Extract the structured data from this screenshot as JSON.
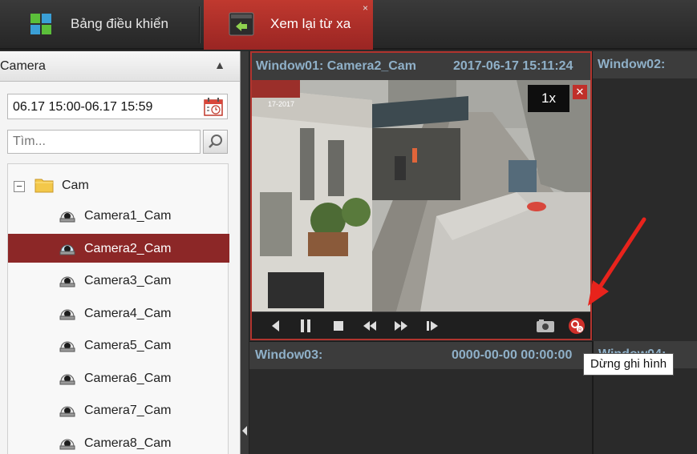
{
  "tabs": {
    "dashboard_label": "Bảng điều khiển",
    "remote_label": "Xem lại từ xa",
    "remote_close": "×"
  },
  "sidebar": {
    "title": "Camera",
    "time_range": "06.17 15:00-06.17 15:59",
    "search_placeholder": "Tìm...",
    "root_label": "Cam",
    "root_toggle": "−",
    "cameras": [
      {
        "label": "Camera1_Cam"
      },
      {
        "label": "Camera2_Cam",
        "selected": true
      },
      {
        "label": "Camera3_Cam"
      },
      {
        "label": "Camera4_Cam"
      },
      {
        "label": "Camera5_Cam"
      },
      {
        "label": "Camera6_Cam"
      },
      {
        "label": "Camera7_Cam"
      },
      {
        "label": "Camera8_Cam"
      }
    ]
  },
  "windows": {
    "w1": {
      "title": "Window01:  Camera2_Cam",
      "timestamp": "2017-06-17 15:11:24",
      "speed": "1x",
      "close": "✕"
    },
    "w2": {
      "title": "Window02:"
    },
    "w3": {
      "title": "Window03:",
      "timestamp": "0000-00-00 00:00:00"
    },
    "w4": {
      "title": "Window04:"
    }
  },
  "tooltip": "Dừng ghi hình",
  "colors": {
    "accent": "#b1342e",
    "selected_row": "#8c2727",
    "title_text": "#8fb0c8"
  }
}
